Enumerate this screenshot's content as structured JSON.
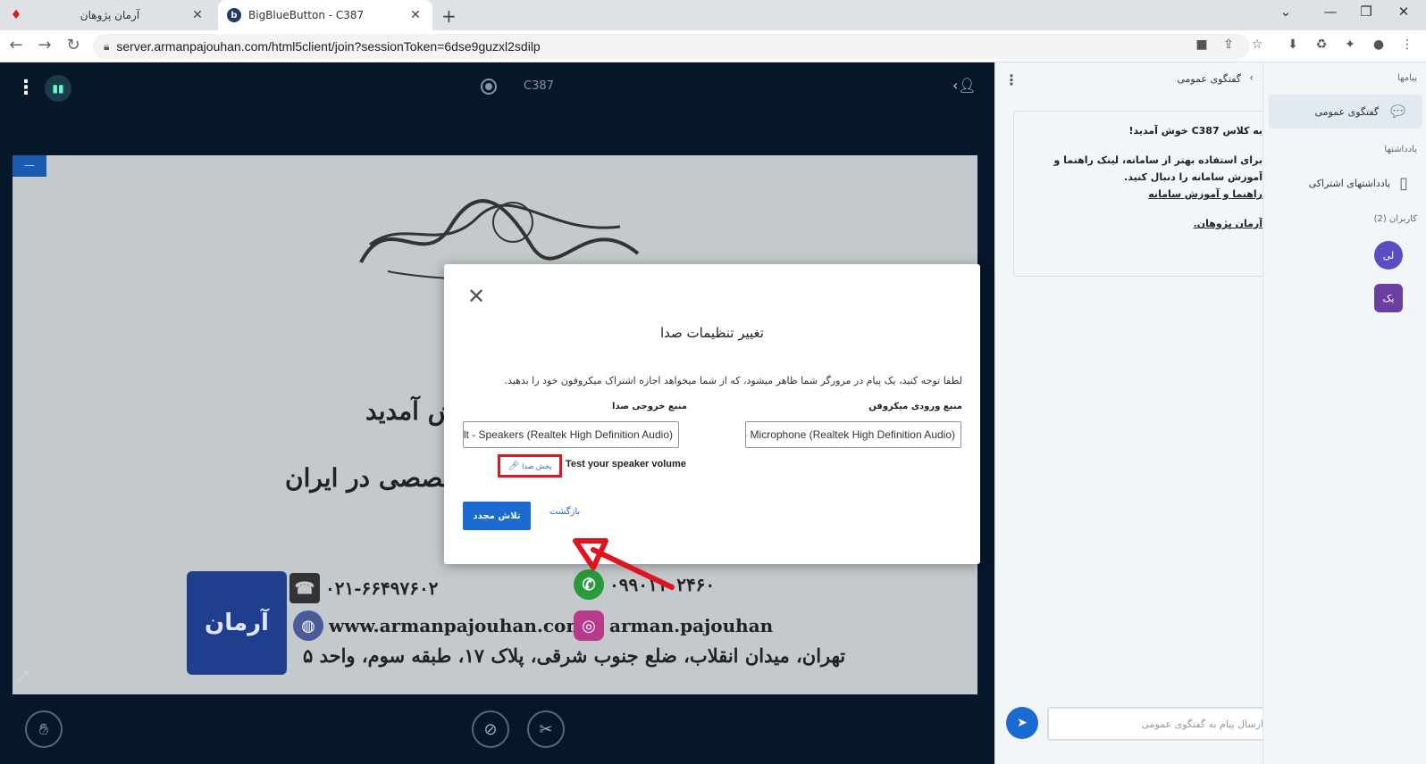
{
  "browser": {
    "tabs": [
      {
        "title": "آرمان پژوهان",
        "icon": "ruby-icon",
        "active": false
      },
      {
        "title": "BigBlueButton - C387",
        "icon": "bbb-icon",
        "active": true
      }
    ],
    "url": "server.armanpajouhan.com/html5client/join?sessionToken=6dse9guzxl2sdilp"
  },
  "app": {
    "room_title": "C387",
    "bbb_stats_icon": "bar-chart-icon"
  },
  "slide": {
    "welcome_text": "ش آمدید",
    "specialized_text": "خصصی در ایران",
    "logo_text": "آرمان",
    "phone": "۰۲۱-۶۶۴۹۷۶۰۲",
    "whatsapp": "۰۹۹۰۱۱۰۲۴۶۰",
    "website": "www.armanpajouhan.com",
    "instagram": "arman.pajouhan",
    "address": "تهران، میدان انقلاب، ضلع جنوب شرقی، پلاک ۱۷، طبقه سوم، واحد ۵"
  },
  "chat": {
    "title": "گفتگوی عمومی",
    "welcome_line": "به کلاس C387 خوش آمدید!",
    "info_line": "برای استفاده بهتر از سامانه، لینک راهنما و آموزش سامانه را دنبال کنید.",
    "guide_link": "راهنما و آموزش سامانه",
    "author_link": "آرمان پژوهان.",
    "input_placeholder": "ارسال پیام به گفتگوی عمومی"
  },
  "user_panel": {
    "messages_section": "پیامها",
    "public_chat_item": "گفتگوی عمومی",
    "notes_section": "یادداشتها",
    "shared_notes_item": "یادداشتهای اشتراکی",
    "users_section": "کاربران (2)",
    "user1_initials": "لی",
    "user2_initials": "یک",
    "avatar1_color": "#5b4cc4",
    "avatar2_color": "#6b3fa0"
  },
  "modal": {
    "title": "تغییر تنظیمات صدا",
    "notice": "لطفا توجه کنید، یک پیام در مرورگر شما ظاهر میشود، که از شما میخواهد اجازه اشتراک میکروفون خود را بدهید.",
    "mic_label": "منبع ورودی میکروفن",
    "speaker_label": "منبع خروجی صدا",
    "mic_value": "Default - Microphone (Realtek High Definition Audio)",
    "speaker_value": "Default - Speakers (Realtek High Definition Audio)",
    "test_speaker_label": "Test your speaker volume",
    "play_sound_label": "پخش صدا",
    "retry_label": "تلاش مجدد",
    "back_label": "بازگشت",
    "highlight_color": "#e0141e",
    "accent_color": "#1a6ad0"
  }
}
